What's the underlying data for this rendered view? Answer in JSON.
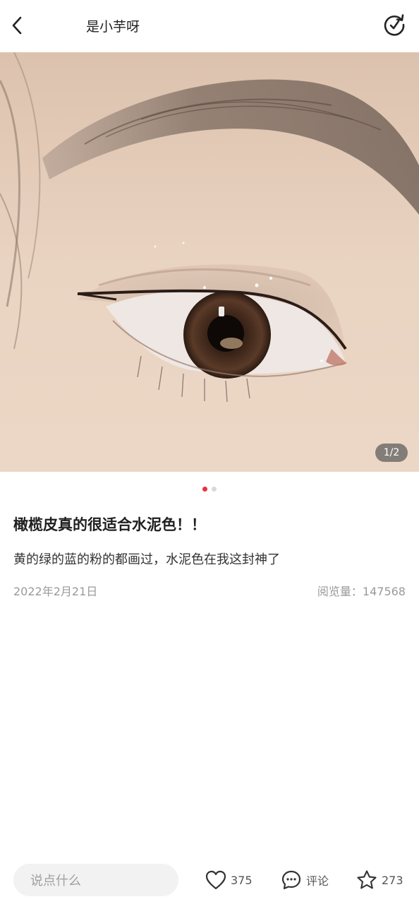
{
  "header": {
    "back_icon": "chevron-left-icon",
    "author_name": "是小芋呀",
    "share_icon": "share-refresh-icon"
  },
  "photo": {
    "counter": "1/2",
    "dots_total": 2,
    "dots_active_index": 0
  },
  "post": {
    "title": "橄榄皮真的很适合水泥色！！",
    "body": "黄的绿的蓝的粉的都画过，水泥色在我这封神了",
    "date": "2022年2月21日",
    "views": "阅览量：147568"
  },
  "bottom_bar": {
    "comment_placeholder": "说点什么",
    "like_count": "375",
    "comment_label": "评论",
    "favorite_count": "273"
  },
  "colors": {
    "accent": "#e8323c",
    "text_primary": "#1f1f1f",
    "text_muted": "#9a9a9a",
    "input_bg": "#f2f2f2"
  }
}
